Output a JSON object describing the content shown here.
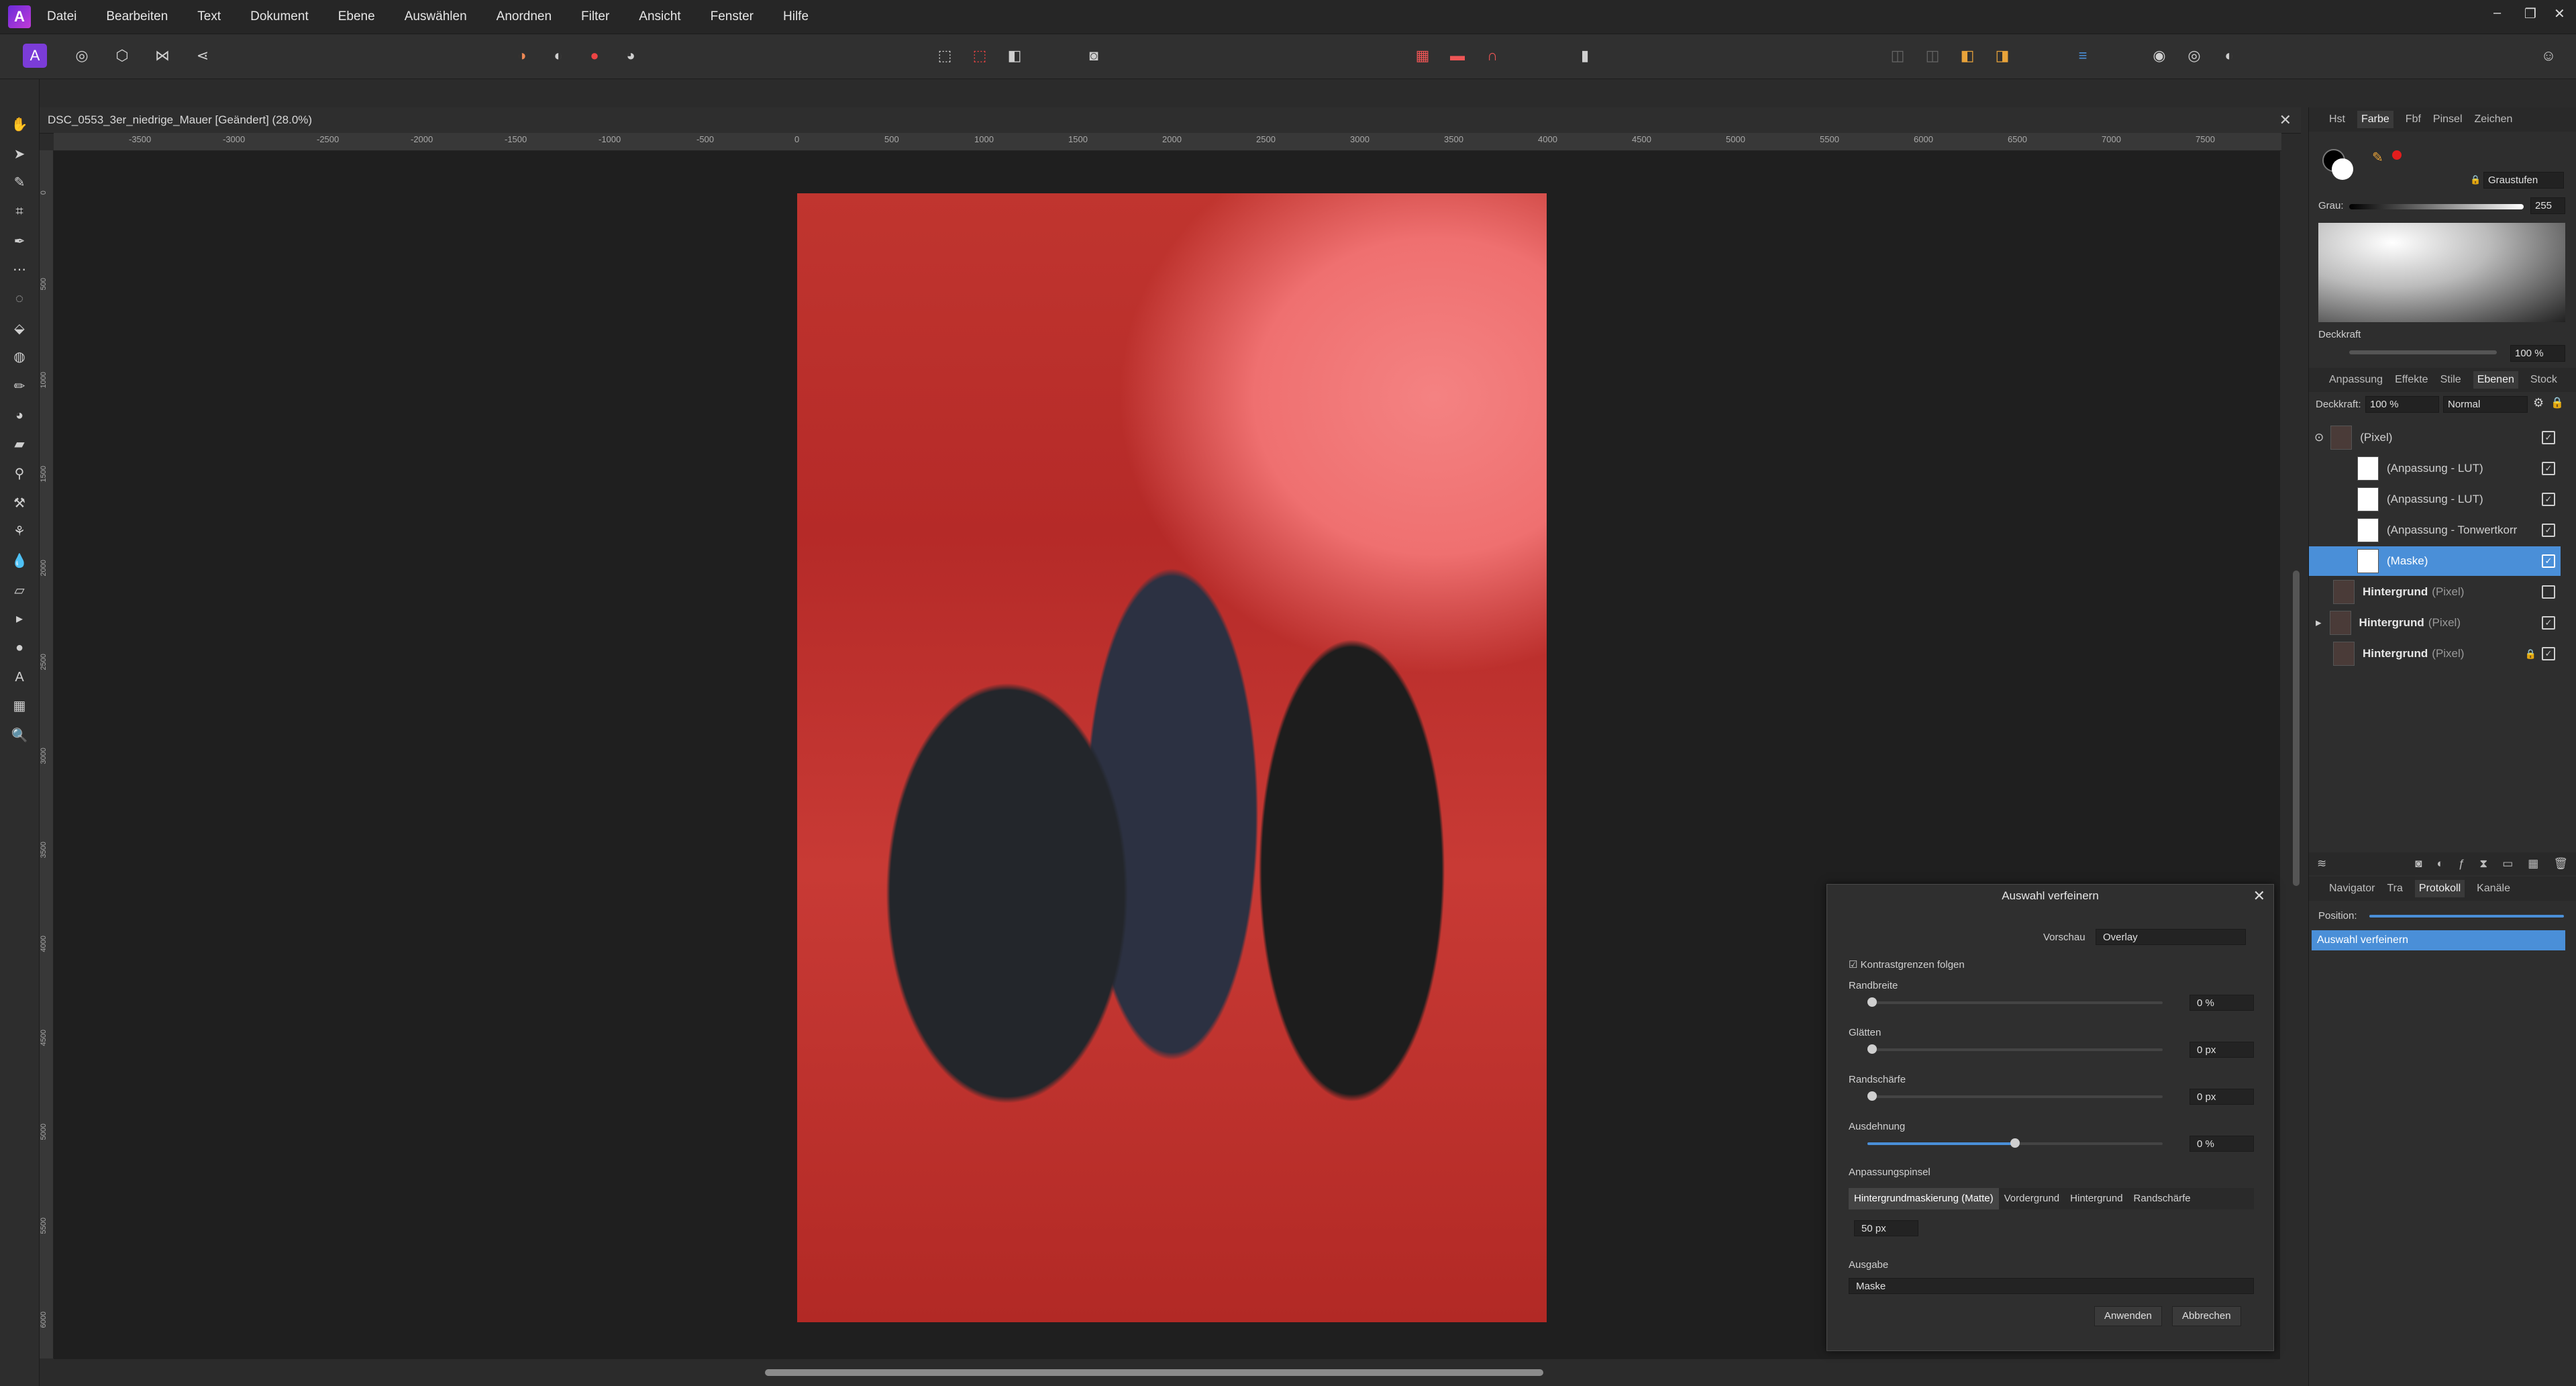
{
  "app": {
    "menu": [
      "Datei",
      "Bearbeiten",
      "Text",
      "Dokument",
      "Ebene",
      "Auswählen",
      "Anordnen",
      "Filter",
      "Ansicht",
      "Fenster",
      "Hilfe"
    ]
  },
  "document": {
    "tab_title": "DSC_0553_3er_niedrige_Mauer [Geändert] (28.0%)",
    "ruler_h": [
      "-3500",
      "-3000",
      "-2500",
      "-2000",
      "-1500",
      "-1000",
      "-500",
      "0",
      "500",
      "1000",
      "1500",
      "2000",
      "2500",
      "3000",
      "3500",
      "4000",
      "4500",
      "5000",
      "5500",
      "6000",
      "6500",
      "7000",
      "7500"
    ],
    "ruler_v": [
      "0",
      "500",
      "1000",
      "1500",
      "2000",
      "2500",
      "3000",
      "3500",
      "4000",
      "4500",
      "5000",
      "5500",
      "6000"
    ]
  },
  "color_panel": {
    "tabs": [
      "Hst",
      "Farbe",
      "Fbf",
      "Pinsel",
      "Zeichen"
    ],
    "active_tab": "Farbe",
    "mode": "Graustufen",
    "gray_label": "Grau:",
    "gray_value": "255",
    "opacity_label": "Deckkraft",
    "opacity_value": "100 %"
  },
  "layers_panel": {
    "tabs": [
      "Anpassung",
      "Effekte",
      "Stile",
      "Ebenen",
      "Stock"
    ],
    "active_tab": "Ebenen",
    "opacity_label": "Deckkraft:",
    "opacity_value": "100 %",
    "blend_mode": "Normal",
    "layers": [
      {
        "name": "",
        "type": "(Pixel)"
      },
      {
        "name": "",
        "type": "(Anpassung - LUT)"
      },
      {
        "name": "",
        "type": "(Anpassung - LUT)"
      },
      {
        "name": "",
        "type": "(Anpassung - Tonwertkorr"
      },
      {
        "name": "",
        "type": "(Maske)"
      },
      {
        "name": "Hintergrund",
        "type": "(Pixel)"
      },
      {
        "name": "Hintergrund",
        "type": "(Pixel)"
      },
      {
        "name": "Hintergrund",
        "type": "(Pixel)"
      }
    ]
  },
  "history_panel": {
    "tabs": [
      "Navigator",
      "Tra",
      "Protokoll",
      "Kanäle"
    ],
    "active_tab": "Protokoll",
    "position_label": "Position:",
    "entries": [
      "Auswahl verfeinern"
    ]
  },
  "dialog": {
    "title": "Auswahl verfeinern",
    "preview_label": "Vorschau",
    "preview_value": "Overlay",
    "checkbox_label": "Kontrastgrenzen folgen",
    "sliders": [
      {
        "label": "Randbreite",
        "value": "0 %",
        "level": 0
      },
      {
        "label": "Glätten",
        "value": "0 px",
        "level": 0
      },
      {
        "label": "Randschärfe",
        "value": "0 px",
        "level": 0
      },
      {
        "label": "Ausdehnung",
        "value": "0 %",
        "level": 0.5
      }
    ],
    "brush_label": "Anpassungspinsel",
    "brush_modes": [
      "Hintergrundmaskierung (Matte)",
      "Vordergrund",
      "Hintergrund",
      "Randschärfe"
    ],
    "brush_size": "50 px",
    "output_label": "Ausgabe",
    "output_value": "Maske",
    "apply": "Anwenden",
    "cancel": "Abbrechen"
  }
}
